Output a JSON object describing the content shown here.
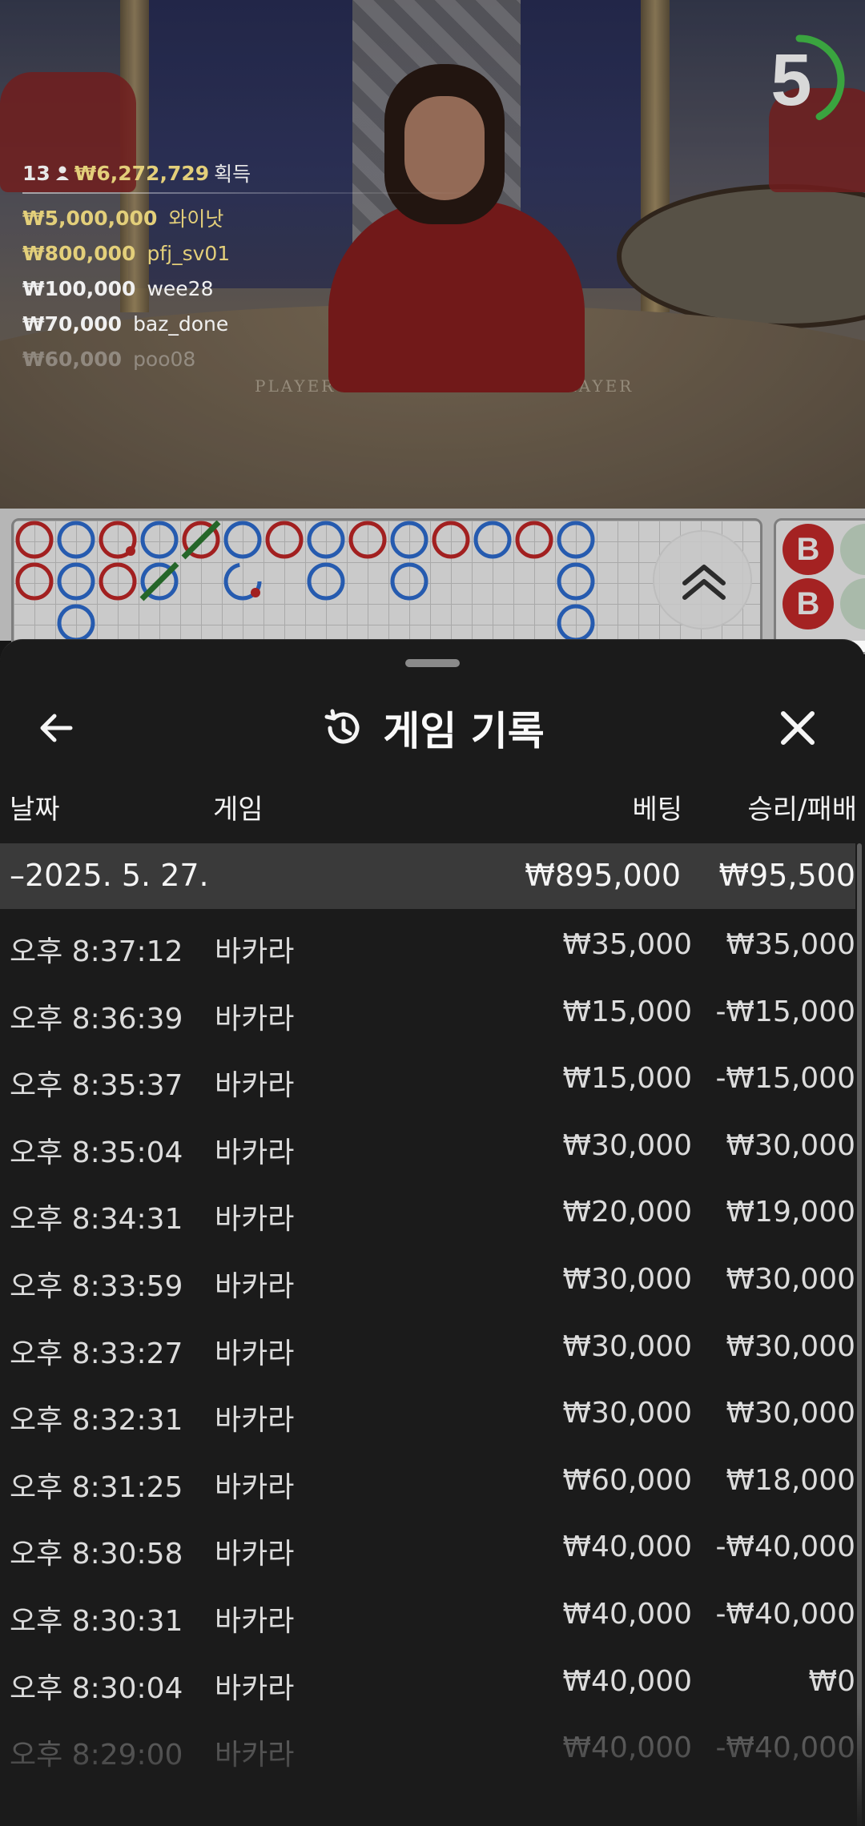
{
  "video": {
    "table_label_left": "PLAYER",
    "table_label_right": "PLAYER",
    "countdown": "5",
    "countdown_progress": 0.42,
    "winners": {
      "count": "13",
      "total": "₩6,272,729",
      "gain_label": "획득",
      "list": [
        {
          "amount": "₩5,000,000",
          "user": "와이낫"
        },
        {
          "amount": "₩800,000",
          "user": "pfj_sv01"
        },
        {
          "amount": "₩100,000",
          "user": "wee28"
        },
        {
          "amount": "₩70,000",
          "user": "baz_done"
        },
        {
          "amount": "₩60,000",
          "user": "poo08"
        }
      ]
    }
  },
  "roadmap": {
    "bead_colors": {
      "banker": "#c62828",
      "player": "#2f6fd6",
      "tie": "#2e7d32"
    },
    "big_road_label": "B"
  },
  "sheet": {
    "title": "게임 기록",
    "icons": {
      "back": "arrow-left-icon",
      "history": "history-icon",
      "close": "close-icon"
    },
    "columns": {
      "date": "날짜",
      "game": "게임",
      "bet": "베팅",
      "win": "승리/패배"
    },
    "date_group": {
      "date": "–2025. 5. 27.",
      "bet_total": "₩895,000",
      "win_total": "₩95,500"
    },
    "rows": [
      {
        "time": "오후 8:37:12",
        "game": "바카라",
        "bet": "₩35,000",
        "win": "₩35,000"
      },
      {
        "time": "오후 8:36:39",
        "game": "바카라",
        "bet": "₩15,000",
        "win": "-₩15,000"
      },
      {
        "time": "오후 8:35:37",
        "game": "바카라",
        "bet": "₩15,000",
        "win": "-₩15,000"
      },
      {
        "time": "오후 8:35:04",
        "game": "바카라",
        "bet": "₩30,000",
        "win": "₩30,000"
      },
      {
        "time": "오후 8:34:31",
        "game": "바카라",
        "bet": "₩20,000",
        "win": "₩19,000"
      },
      {
        "time": "오후 8:33:59",
        "game": "바카라",
        "bet": "₩30,000",
        "win": "₩30,000"
      },
      {
        "time": "오후 8:33:27",
        "game": "바카라",
        "bet": "₩30,000",
        "win": "₩30,000"
      },
      {
        "time": "오후 8:32:31",
        "game": "바카라",
        "bet": "₩30,000",
        "win": "₩30,000"
      },
      {
        "time": "오후 8:31:25",
        "game": "바카라",
        "bet": "₩60,000",
        "win": "₩18,000"
      },
      {
        "time": "오후 8:30:58",
        "game": "바카라",
        "bet": "₩40,000",
        "win": "-₩40,000"
      },
      {
        "time": "오후 8:30:31",
        "game": "바카라",
        "bet": "₩40,000",
        "win": "-₩40,000"
      },
      {
        "time": "오후 8:30:04",
        "game": "바카라",
        "bet": "₩40,000",
        "win": "₩0"
      },
      {
        "time": "오후 8:29:00",
        "game": "바카라",
        "bet": "₩40,000",
        "win": "-₩40,000"
      }
    ]
  }
}
